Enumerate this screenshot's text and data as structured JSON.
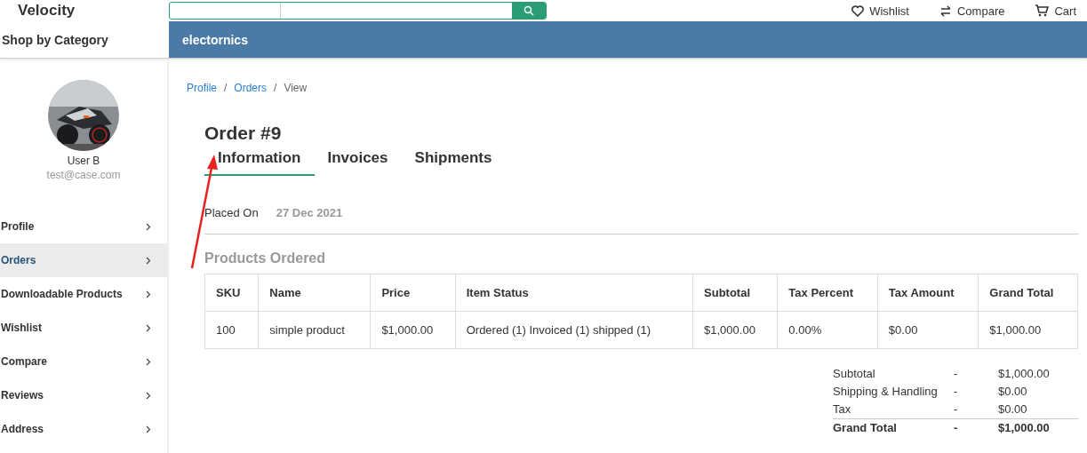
{
  "header": {
    "logo": "Velocity",
    "search": {
      "kind": "category-search"
    },
    "links": [
      {
        "kind": "wishlist",
        "label": "Wishlist"
      },
      {
        "kind": "compare",
        "label": "Compare"
      },
      {
        "kind": "cart",
        "label": "Cart"
      }
    ]
  },
  "category_bar": {
    "title": "Shop by Category",
    "items": [
      "electornics"
    ]
  },
  "sidebar": {
    "user": {
      "name": "User B",
      "email": "test@case.com"
    },
    "items": [
      {
        "label": "Profile",
        "selected": false
      },
      {
        "label": "Orders",
        "selected": true
      },
      {
        "label": "Downloadable Products",
        "selected": false
      },
      {
        "label": "Wishlist",
        "selected": false
      },
      {
        "label": "Compare",
        "selected": false
      },
      {
        "label": "Reviews",
        "selected": false
      },
      {
        "label": "Address",
        "selected": false
      }
    ]
  },
  "breadcrumb": [
    {
      "label": "Profile",
      "link": true
    },
    {
      "separator": "/",
      "label": "Orders",
      "link": true
    },
    {
      "separator": "/",
      "label": "View",
      "link": false
    }
  ],
  "title": "Order #9",
  "tabs": [
    {
      "label": "Information",
      "selected": true
    },
    {
      "label": "Invoices",
      "selected": false
    },
    {
      "label": "Shipments",
      "selected": false
    }
  ],
  "placed_on": {
    "label": "Placed On",
    "value": "27 Dec 2021"
  },
  "products_title": "Products Ordered",
  "table": {
    "columns": [
      "SKU",
      "Name",
      "Price",
      "Item Status",
      "Subtotal",
      "Tax Percent",
      "Tax Amount",
      "Grand Total"
    ],
    "rows": [
      [
        "100",
        "simple product",
        "$1,000.00",
        "Ordered (1) Invoiced (1) shipped (1)",
        "$1,000.00",
        "0.00%",
        "$0.00",
        "$1,000.00"
      ]
    ]
  },
  "totals": [
    {
      "label": "Subtotal",
      "sep": "-",
      "value": "$1,000.00",
      "kind": "normal"
    },
    {
      "label": "Shipping & Handling",
      "sep": "-",
      "value": "$0.00",
      "kind": "normal"
    },
    {
      "label": "Tax",
      "sep": "-",
      "value": "$0.00",
      "kind": "normal"
    },
    {
      "label": "Grand Total",
      "sep": "-",
      "value": "$1,000.00",
      "kind": "grand"
    }
  ],
  "annotation": {
    "kind": "arrow"
  }
}
